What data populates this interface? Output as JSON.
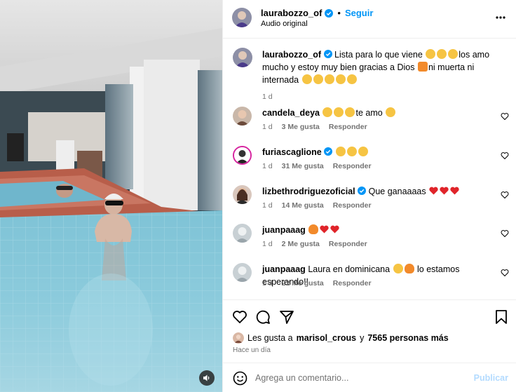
{
  "post": {
    "author": "laurabozzo_of",
    "follow_label": "Seguir",
    "audio": "Audio original",
    "separator": "•"
  },
  "caption": {
    "author": "laurabozzo_of",
    "text_1": "Lista para lo que viene",
    "text_2": "los amo mucho y estoy muy bien gracias a Dios",
    "text_3": "ni muerta ni internada",
    "time": "1 d"
  },
  "comments": [
    {
      "user": "candela_deya",
      "text": "te amo",
      "time": "1 d",
      "likes": "3 Me gusta",
      "reply": "Responder"
    },
    {
      "user": "furiascaglione",
      "text": "",
      "time": "1 d",
      "likes": "31 Me gusta",
      "reply": "Responder"
    },
    {
      "user": "lizbethrodriguezoficial",
      "text": "Que ganaaaas",
      "time": "1 d",
      "likes": "14 Me gusta",
      "reply": "Responder"
    },
    {
      "user": "juanpaaag",
      "text": "",
      "time": "1 d",
      "likes": "2 Me gusta",
      "reply": "Responder"
    },
    {
      "user": "juanpaaag",
      "text_1": "Laura en dominicana",
      "text_2": "lo estamos esperando!!",
      "time": "1 d",
      "likes": "22 Me gusta",
      "reply": "Responder"
    }
  ],
  "likes": {
    "prefix": "Les gusta a",
    "user": "marisol_crous",
    "conj": "y",
    "count": "7565 personas más"
  },
  "time_ago": "Hace un día",
  "composer": {
    "placeholder": "Agrega un comentario...",
    "publish": "Publicar"
  },
  "icons": [
    "audio-icon",
    "more-icon",
    "verified-icon",
    "heart-icon",
    "comment-icon",
    "share-icon",
    "bookmark-icon",
    "emoji-icon"
  ],
  "colors": {
    "accent": "#0095f6",
    "muted": "#737373",
    "publish_disabled": "#b3dbff"
  }
}
